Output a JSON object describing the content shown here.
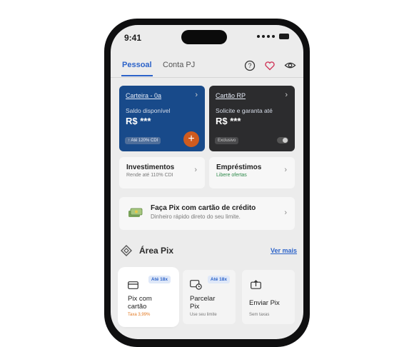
{
  "status_bar": {
    "time": "9:41"
  },
  "tabs": {
    "active": "Pessoal",
    "other": "Conta PJ"
  },
  "header_icons": [
    "help-circle-icon",
    "heart-icon",
    "eye-icon"
  ],
  "cards": [
    {
      "title": "Carteira - 0a",
      "subtitle": "Saldo disponível",
      "value": "R$ ***",
      "pill": "↑ Até 120% CDI"
    },
    {
      "title": "Cartão RP",
      "subtitle": "Solicite e garanta até",
      "value": "R$ ***",
      "pill": "Exclusivo"
    }
  ],
  "tiles": [
    {
      "title": "Investimentos",
      "subtitle": "Rende até 110% CDI"
    },
    {
      "title": "Empréstimos",
      "subtitle": "Libere ofertas"
    }
  ],
  "banner": {
    "title": "Faça Pix com cartão de crédito",
    "subtitle": "Dinheiro rápido direto do seu limite."
  },
  "area_pix": {
    "title": "Área Pix",
    "link": "Ver mais"
  },
  "pix_options": [
    {
      "badge": "Até 18x",
      "title": "Pix com cartão",
      "subtitle": "Taxa 3,99%"
    },
    {
      "badge": "Até 18x",
      "title": "Parcelar Pix",
      "subtitle": "Use seu limite"
    },
    {
      "badge": "",
      "title": "Enviar Pix",
      "subtitle": "Sem taxas"
    }
  ],
  "colors": {
    "accent": "#2c63c9",
    "card_blue": "#184a8a",
    "card_dark": "#2c2c2e",
    "plus_orange": "#cf5b1e",
    "taxa_orange": "#e37a24"
  }
}
